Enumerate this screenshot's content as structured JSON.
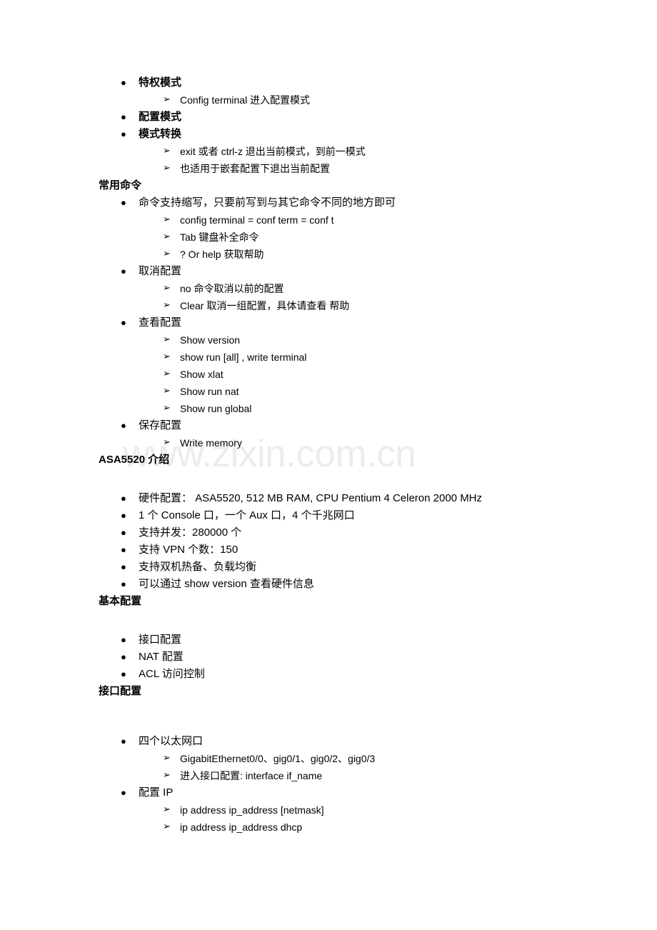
{
  "document": {
    "watermark": "www.zixin.com.cn",
    "blocks": [
      {
        "type": "bullet1",
        "bold": true,
        "marker": "●",
        "text": "特权模式"
      },
      {
        "type": "bullet2",
        "marker": "➢",
        "text": "Config terminal  进入配置模式"
      },
      {
        "type": "bullet1",
        "bold": true,
        "marker": "●",
        "text": "配置模式"
      },
      {
        "type": "bullet1",
        "bold": true,
        "marker": "●",
        "text": "模式转换"
      },
      {
        "type": "bullet2",
        "marker": "➢",
        "text": "exit 或者 ctrl-z 退出当前模式，到前一模式"
      },
      {
        "type": "bullet2",
        "marker": "➢",
        "text": "也适用于嵌套配置下退出当前配置"
      },
      {
        "type": "heading",
        "text": "常用命令"
      },
      {
        "type": "bullet1",
        "marker": "●",
        "text": "命令支持缩写，只要前写到与其它命令不同的地方即可"
      },
      {
        "type": "bullet2",
        "marker": "➢",
        "text": "config terminal = conf term = conf t"
      },
      {
        "type": "bullet2",
        "marker": "➢",
        "text": "Tab 键盘补全命令"
      },
      {
        "type": "bullet2",
        "marker": "➢",
        "text": "?   Or help 获取帮助"
      },
      {
        "type": "bullet1",
        "marker": "●",
        "text": "取消配置"
      },
      {
        "type": "bullet2",
        "marker": "➢",
        "text": "no  命令取消以前的配置"
      },
      {
        "type": "bullet2",
        "marker": "➢",
        "text": "Clear 取消一组配置，具体请查看 帮助"
      },
      {
        "type": "bullet1",
        "marker": "●",
        "text": "查看配置"
      },
      {
        "type": "bullet2",
        "marker": "➢",
        "text": "Show version"
      },
      {
        "type": "bullet2",
        "marker": "➢",
        "text": "show run [all] , write terminal"
      },
      {
        "type": "bullet2",
        "marker": "➢",
        "text": "Show xlat"
      },
      {
        "type": "bullet2",
        "marker": "➢",
        "text": "Show run nat"
      },
      {
        "type": "bullet2",
        "marker": "➢",
        "text": "Show run global"
      },
      {
        "type": "bullet1",
        "marker": "●",
        "text": "保存配置"
      },
      {
        "type": "bullet2",
        "marker": "➢",
        "text": "Write memory"
      },
      {
        "type": "heading",
        "text": "ASA5520 介绍"
      },
      {
        "type": "spacer",
        "size": 30
      },
      {
        "type": "bullet1",
        "marker": "●",
        "text": "硬件配置：  ASA5520, 512 MB RAM, CPU Pentium 4 Celeron 2000 MHz"
      },
      {
        "type": "bullet1",
        "marker": "●",
        "text": "1 个 Console 口，一个 Aux 口，4 个千兆网口"
      },
      {
        "type": "bullet1",
        "marker": "●",
        "text": "支持并发：280000 个"
      },
      {
        "type": "bullet1",
        "marker": "●",
        "text": "支持 VPN 个数：150"
      },
      {
        "type": "bullet1",
        "marker": "●",
        "text": "支持双机热备、负载均衡"
      },
      {
        "type": "bullet1",
        "marker": "●",
        "text": "可以通过 show version 查看硬件信息"
      },
      {
        "type": "heading",
        "text": "基本配置"
      },
      {
        "type": "spacer",
        "size": 30
      },
      {
        "type": "bullet1",
        "marker": "●",
        "text": "接口配置"
      },
      {
        "type": "bullet1",
        "marker": "●",
        "text": "NAT 配置"
      },
      {
        "type": "bullet1",
        "marker": "●",
        "text": "ACL 访问控制"
      },
      {
        "type": "heading",
        "text": "接口配置"
      },
      {
        "type": "spacer",
        "size": 46
      },
      {
        "type": "bullet1",
        "marker": "●",
        "text": "四个以太网口"
      },
      {
        "type": "bullet2",
        "marker": "➢",
        "text": "GigabitEthernet0/0、gig0/1、gig0/2、gig0/3"
      },
      {
        "type": "bullet2",
        "marker": "➢",
        "text": "进入接口配置: interface if_name"
      },
      {
        "type": "bullet1",
        "marker": "●",
        "text": "配置 IP"
      },
      {
        "type": "bullet2",
        "marker": "➢",
        "text": "ip   address ip_address [netmask]"
      },
      {
        "type": "bullet2",
        "marker": "➢",
        "text": "ip   address ip_address dhcp"
      }
    ]
  }
}
